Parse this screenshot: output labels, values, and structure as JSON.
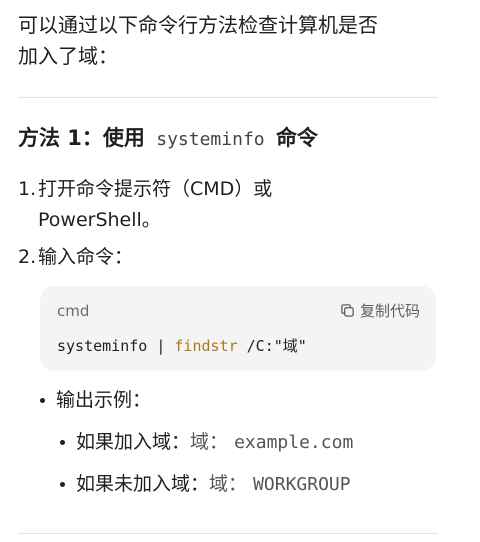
{
  "intro": {
    "line1": "可以通过以下命令行方法检查计算机是否",
    "line2": "加入了域："
  },
  "method1": {
    "prefix": "方法 1：使用",
    "code": "systeminfo",
    "suffix": "命令"
  },
  "steps": [
    {
      "num": "1.",
      "line1": "打开命令提示符（CMD）或",
      "line2": "PowerShell。"
    },
    {
      "num": "2.",
      "line1": "输入命令："
    }
  ],
  "code_block": {
    "language": "cmd",
    "copy_label": "复制代码",
    "copy_icon": "copy-icon",
    "code_pre": "systeminfo | ",
    "code_fn": "findstr",
    "code_post": " /C:\"域\""
  },
  "example": {
    "label": "输出示例：",
    "items": [
      {
        "label": "如果加入域：",
        "key": "域：",
        "value": "example.com"
      },
      {
        "label": "如果未加入域：",
        "key": "域：",
        "value": "WORKGROUP"
      }
    ]
  },
  "colors": {
    "text": "#1f1f1f",
    "code_bg": "#f3f4f6",
    "token_function": "#b07a12",
    "divider": "#e3e3e3"
  }
}
